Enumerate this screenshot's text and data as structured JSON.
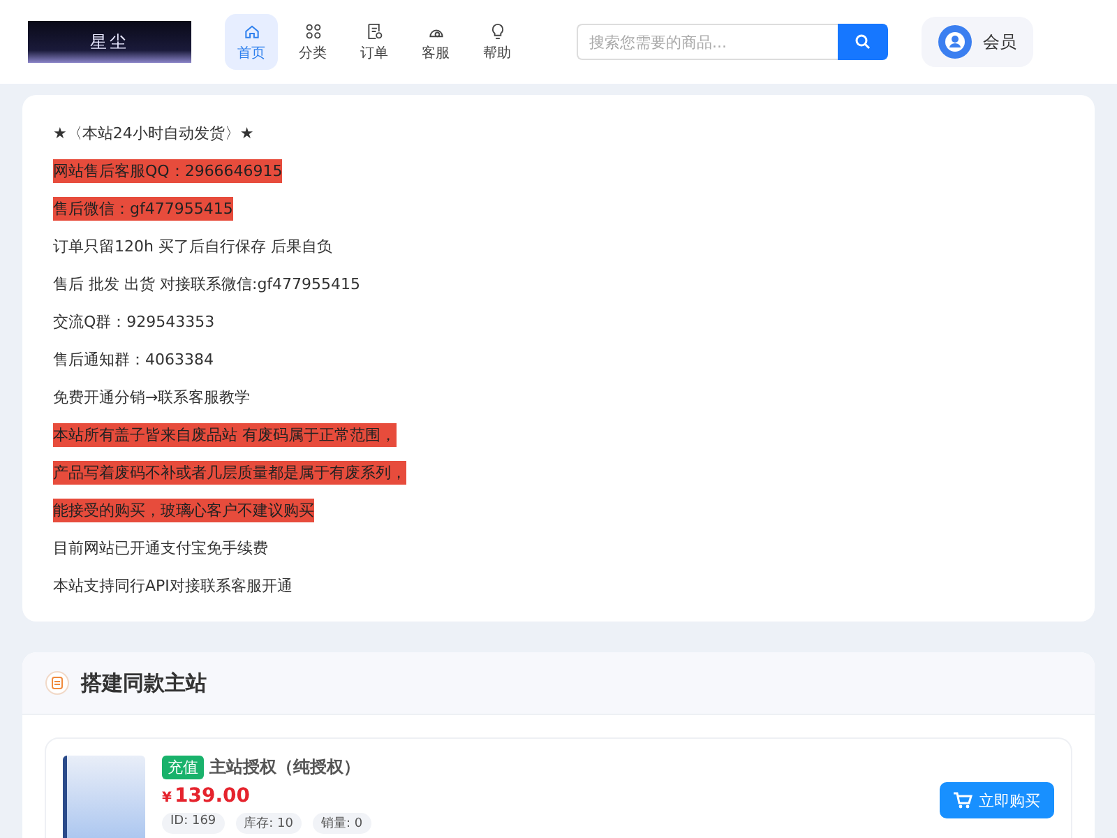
{
  "header": {
    "logo": "星尘",
    "nav": [
      {
        "label": "首页",
        "kind": "home",
        "selected": true
      },
      {
        "label": "分类",
        "kind": "grid",
        "selected": false
      },
      {
        "label": "订单",
        "kind": "order",
        "selected": false
      },
      {
        "label": "客服",
        "kind": "service",
        "selected": false
      },
      {
        "label": "帮助",
        "kind": "bulb",
        "selected": false
      }
    ],
    "search": {
      "placeholder": "搜索您需要的商品..."
    },
    "member": "会员"
  },
  "notice": [
    {
      "text": "★〈本站24小时自动发货〉★",
      "highlight": false
    },
    {
      "text": "网站售后客服QQ：2966646915",
      "highlight": true
    },
    {
      "text": "售后微信：gf477955415",
      "highlight": true
    },
    {
      "text": "订单只留120h 买了后自行保存 后果自负",
      "highlight": false
    },
    {
      "text": "售后 批发 出货 对接联系微信:gf477955415",
      "highlight": false
    },
    {
      "text": "交流Q群：929543353",
      "highlight": false
    },
    {
      "text": "售后通知群：4063384",
      "highlight": false
    },
    {
      "text": "免费开通分销→联系客服教学",
      "highlight": false
    },
    {
      "text": "本站所有盖子皆来自废品站 有废码属于正常范围，",
      "highlight": true
    },
    {
      "text": "产品写着废码不补或者几层质量都是属于有废系列，",
      "highlight": true
    },
    {
      "text": "能接受的购买，玻璃心客户不建议购买",
      "highlight": true
    },
    {
      "text": "目前网站已开通支付宝免手续费",
      "highlight": false
    },
    {
      "text": "本站支持同行API对接联系客服开通",
      "highlight": false
    }
  ],
  "section": {
    "title": "搭建同款主站",
    "products": [
      {
        "tag": "充值",
        "name": "主站授权（纯授权）",
        "currency": "¥",
        "price": "139.00",
        "stats": [
          "ID: 169",
          "库存: 10",
          "销量: 0"
        ],
        "buy": "立即购买"
      }
    ]
  }
}
